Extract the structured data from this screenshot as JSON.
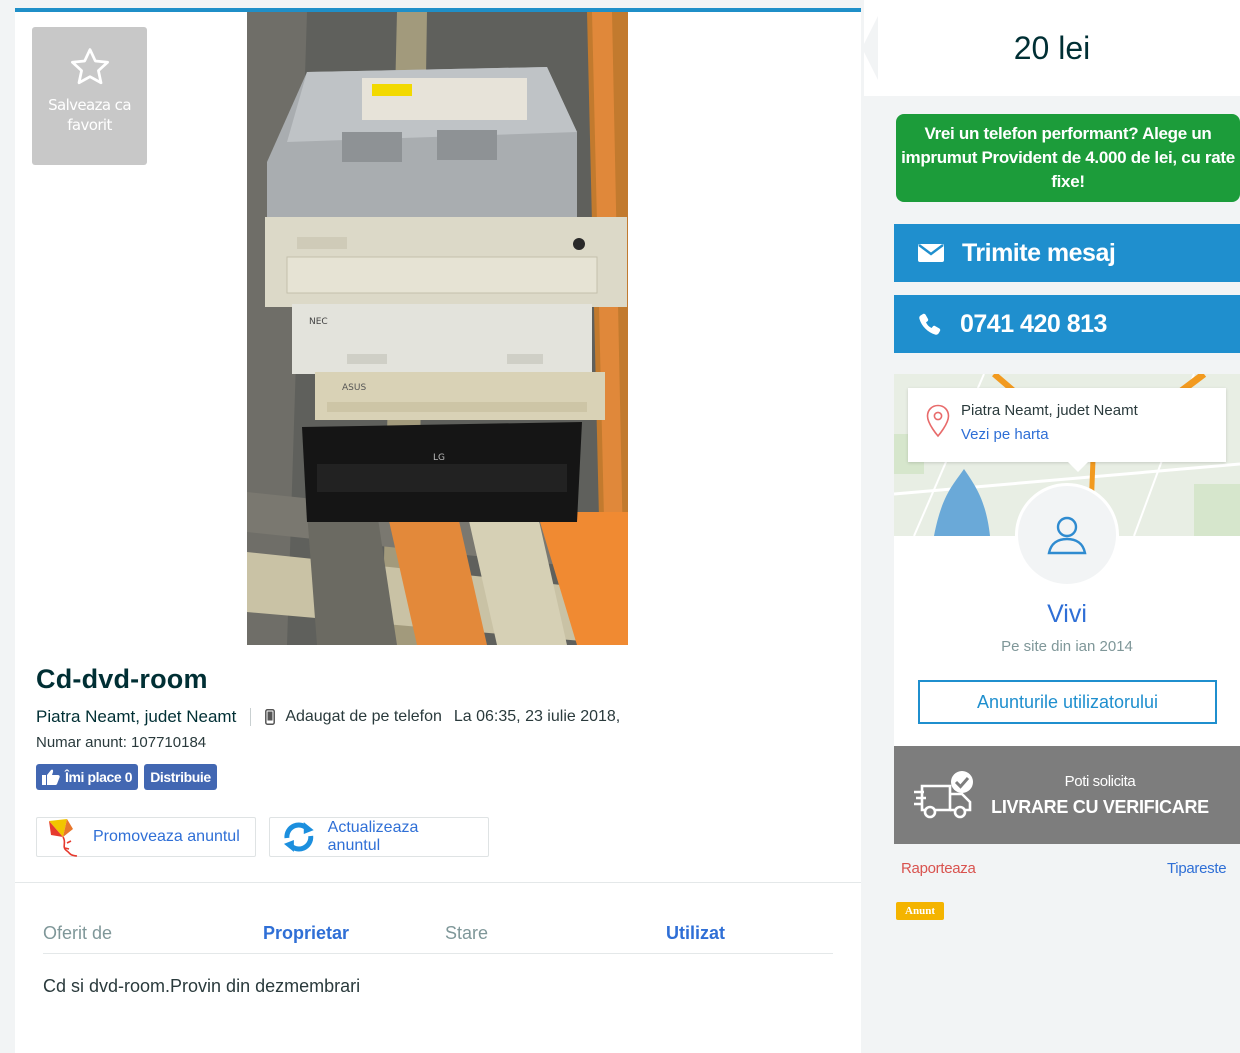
{
  "favorite": {
    "label": "Salveaza ca favorit",
    "icon": "star-outline-icon"
  },
  "ad": {
    "title": "Cd-dvd-room",
    "location": "Piatra Neamt, judet Neamt",
    "added_via": "Adaugat de pe telefon",
    "added_at": "La 06:35, 23 iulie 2018,",
    "number": "Numar anunt: 107710184",
    "description": "Cd si dvd-room.Provin din dezmembrari"
  },
  "facebook": {
    "like_label": "Îmi place 0",
    "share_label": "Distribuie"
  },
  "actions": {
    "promote_label": "Promoveaza anuntul",
    "update_label": "Actualizeaza anuntul"
  },
  "details": [
    {
      "label": "Oferit de",
      "value": "Proprietar"
    },
    {
      "label": "Stare",
      "value": "Utilizat"
    }
  ],
  "sidebar": {
    "price": "20 lei",
    "promo_banner": "Vrei un telefon performant? Alege un imprumut Provident de 4.000 de lei, cu rate fixe!",
    "message_label": "Trimite mesaj",
    "phone_label": "0741 420 813",
    "map": {
      "city": "Piatra Neamt, judet Neamt",
      "link": "Vezi pe harta"
    },
    "user": {
      "name": "Vivi",
      "since": "Pe site din ian 2014",
      "ads_button": "Anunturile utilizatorului"
    },
    "delivery": {
      "sub": "Poti solicita",
      "main": "LIVRARE CU VERIFICARE"
    },
    "report_label": "Raporteaza",
    "print_label": "Tipareste",
    "ad_badge": "Anunt"
  },
  "colors": {
    "accent": "#1f8fce",
    "promo_green": "#1c9c3a",
    "delivery_gray": "#7d7d7d",
    "link_blue": "#2f6fd6"
  }
}
